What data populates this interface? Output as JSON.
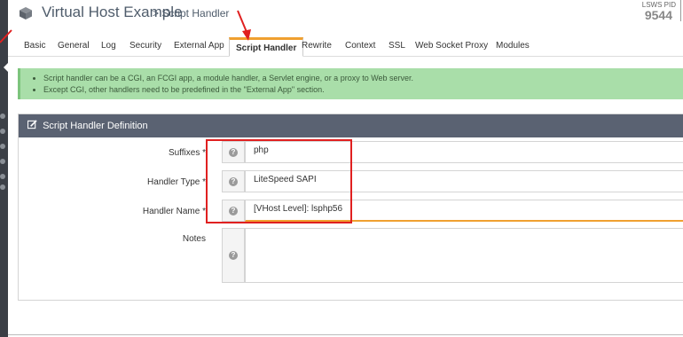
{
  "title": {
    "main": "Virtual Host Example",
    "sub": "> Script Handler",
    "icon": "cube-icon"
  },
  "server": {
    "pid_label": "LSWS PID",
    "pid_value": "9544"
  },
  "tabs": [
    {
      "label": "Basic"
    },
    {
      "label": "General"
    },
    {
      "label": "Log"
    },
    {
      "label": "Security"
    },
    {
      "label": "External App"
    },
    {
      "label": "Script Handler",
      "active": true
    },
    {
      "label": "Rewrite"
    },
    {
      "label": "Context"
    },
    {
      "label": "SSL"
    },
    {
      "label": "Web Socket Proxy"
    },
    {
      "label": "Modules"
    }
  ],
  "info": {
    "lines": [
      "Script handler can be a CGI, an FCGI app, a module handler, a Servlet engine, or a proxy to Web server.",
      "Except CGI, other handlers need to be predefined in the \"External App\" section."
    ]
  },
  "panel": {
    "title": "Script Handler Definition",
    "icon": "edit-icon",
    "fields": [
      {
        "label": "Suffixes *",
        "value": "php"
      },
      {
        "label": "Handler Type *",
        "value": "LiteSpeed SAPI"
      },
      {
        "label": "Handler Name *",
        "value": "[VHost Level]: lsphp56"
      },
      {
        "label": "Notes",
        "value": ""
      }
    ],
    "help_glyph": "?"
  },
  "colors": {
    "accent": "#f0a030",
    "panel_header": "#5a6272",
    "info_bg": "#a9dea9",
    "annotation": "#e02020"
  }
}
